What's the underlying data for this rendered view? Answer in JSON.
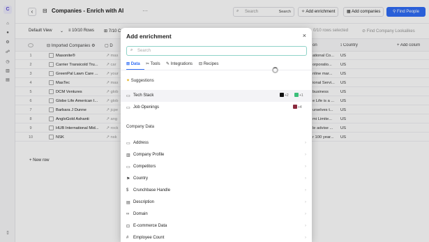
{
  "rail": {
    "logo": "C",
    "items": [
      "home-icon",
      "rocket-icon",
      "settings-icon",
      "people-icon",
      "clock-icon",
      "building-icon",
      "table-icon"
    ],
    "footer_icon": "list-icon"
  },
  "header": {
    "title": "Companies - Enrich with AI",
    "search_placeholder": "Search",
    "search_shortcut": "Search",
    "add_enrichment": "Add enrichment",
    "add_companies": "Add companies",
    "find_people": "Find People"
  },
  "toolbar": {
    "view": "Default View",
    "rows": "10/10 Rows",
    "cols": "7/10 C",
    "selected": "0/10 rows selected",
    "lookalikes": "Find Company Lookalikes"
  },
  "table": {
    "col_imported": "Imported Companies",
    "col_d": "D",
    "col_desc": "on",
    "col_country": "Country",
    "add_column": "+ Add colum",
    "rows": [
      {
        "n": "1",
        "name": "Masonite®",
        "url": "mas",
        "desc": "ational Co...",
        "country": "US"
      },
      {
        "n": "2",
        "name": "Carrier Transicold Tru...",
        "url": "car",
        "desc": "orporatio...",
        "country": "US"
      },
      {
        "n": "3",
        "name": "GreenPal Lawn Care ...",
        "url": "your",
        "desc": "nline mar...",
        "country": "US"
      },
      {
        "n": "4",
        "name": "MasTec",
        "url": "mas",
        "desc": "ional Servi...",
        "country": "US"
      },
      {
        "n": "5",
        "name": "DCM Ventures",
        "url": "glob",
        "desc": "business",
        "country": "US"
      },
      {
        "n": "6",
        "name": "Globe Life American I...",
        "url": "glob",
        "desc": "e Life is a ...",
        "country": "US"
      },
      {
        "n": "7",
        "name": "Barbara J Dunne",
        "url": "jcpe",
        "desc": "urselves t...",
        "country": "US"
      },
      {
        "n": "8",
        "name": "AngloGold Ashanti",
        "url": "ang",
        "desc": "mi Limite...",
        "country": "US"
      },
      {
        "n": "9",
        "name": "HUB International Mid...",
        "url": "rock",
        "desc": "le advise ...",
        "country": "US"
      },
      {
        "n": "10",
        "name": "NSK",
        "url": "nsk",
        "desc": "r 100 year...",
        "country": "US"
      }
    ],
    "new_row": "+ New row"
  },
  "modal": {
    "title": "Add enrichment",
    "search_placeholder": "Search",
    "tabs": [
      "Data",
      "Tools",
      "Integrations",
      "Recipes"
    ],
    "suggestions_title": "Suggestions",
    "suggestions": [
      {
        "label": "Tech Stack",
        "badge1": "+2",
        "badge2": "+1"
      },
      {
        "label": "Job Openings",
        "badge1": "+4"
      }
    ],
    "company_data_title": "Company Data",
    "company_data": [
      "Address",
      "Company Profile",
      "Competitors",
      "Country",
      "Crunchbase Handle",
      "Description",
      "Domain",
      "E-commerce Data",
      "Employee Count"
    ]
  },
  "colors": {
    "accent": "#2f6df6",
    "search_focus": "#8fd3c8"
  }
}
